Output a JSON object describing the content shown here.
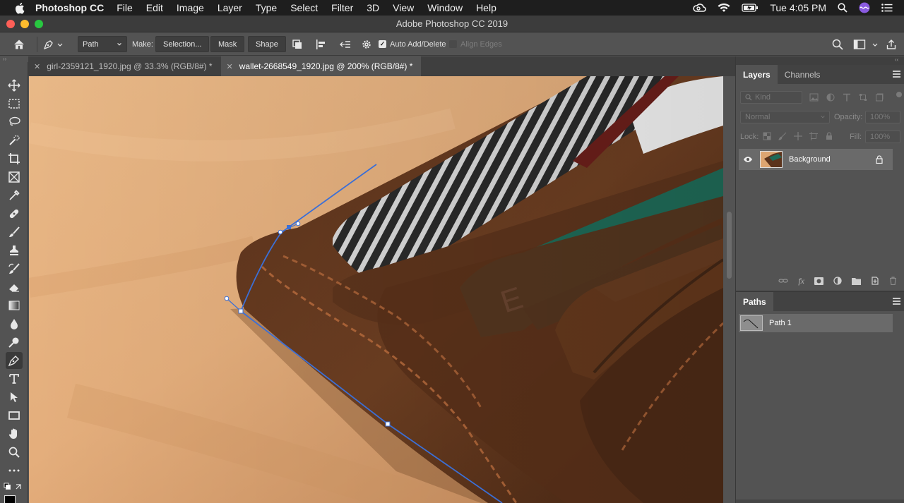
{
  "menubar": {
    "app_name": "Photoshop CC",
    "items": [
      "File",
      "Edit",
      "Image",
      "Layer",
      "Type",
      "Select",
      "Filter",
      "3D",
      "View",
      "Window",
      "Help"
    ],
    "clock": "Tue 4:05 PM"
  },
  "window": {
    "title": "Adobe Photoshop CC 2019"
  },
  "options": {
    "mode_value": "Path",
    "make_label": "Make:",
    "selection_button": "Selection...",
    "mask_button": "Mask",
    "shape_button": "Shape",
    "auto_add_delete": "Auto Add/Delete",
    "align_edges": "Align Edges"
  },
  "tabs": [
    {
      "label": "girl-2359121_1920.jpg @ 33.3% (RGB/8#) *",
      "active": false
    },
    {
      "label": "wallet-2668549_1920.jpg @ 200% (RGB/8#) *",
      "active": true
    }
  ],
  "layers_panel": {
    "tabs": [
      "Layers",
      "Channels"
    ],
    "kind_placeholder": "Kind",
    "blend_mode": "Normal",
    "opacity_label": "Opacity:",
    "opacity_value": "100%",
    "lock_label": "Lock:",
    "fill_label": "Fill:",
    "fill_value": "100%",
    "layers": [
      {
        "name": "Background",
        "locked": true,
        "visible": true
      }
    ]
  },
  "paths_panel": {
    "title": "Paths",
    "paths": [
      {
        "name": "Path 1"
      }
    ]
  },
  "colors": {
    "accent_path": "#3b6fd6",
    "panel_bg": "#535353"
  }
}
